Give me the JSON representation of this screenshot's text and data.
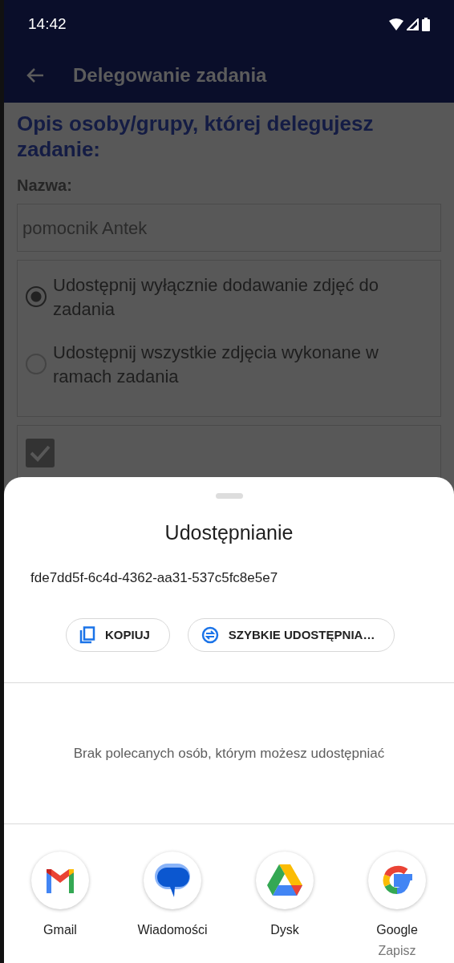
{
  "status_bar": {
    "time": "14:42"
  },
  "app_bar": {
    "title": "Delegowanie zadania"
  },
  "form": {
    "heading": "Opis osoby/grupy, której delegujesz zadanie:",
    "name_label": "Nazwa:",
    "name_value": "pomocnik Antek",
    "options": [
      {
        "label": "Udostępnij wyłącznie dodawanie zdjęć do zadania",
        "selected": true
      },
      {
        "label": "Udostępnij wszystkie zdjęcia wykonane w ramach zadania",
        "selected": false
      }
    ],
    "consent_checkbox": {
      "checked": true
    }
  },
  "share_sheet": {
    "title": "Udostępnianie",
    "shared_text": "fde7dd5f-6c4d-4362-aa31-537c5fc8e5e7",
    "actions": [
      {
        "label": "KOPIUJ",
        "kind": "copy"
      },
      {
        "label": "SZYBKIE UDOSTĘPNIA…",
        "kind": "quick-share"
      }
    ],
    "empty_message": "Brak polecanych osób, którym możesz udostępniać",
    "apps": [
      {
        "name": "Gmail",
        "kind": "gmail"
      },
      {
        "name": "Wiadomości",
        "kind": "messages"
      },
      {
        "name": "Dysk",
        "kind": "drive"
      },
      {
        "name": "Google",
        "subtitle": "Zapisz",
        "kind": "google"
      }
    ]
  }
}
